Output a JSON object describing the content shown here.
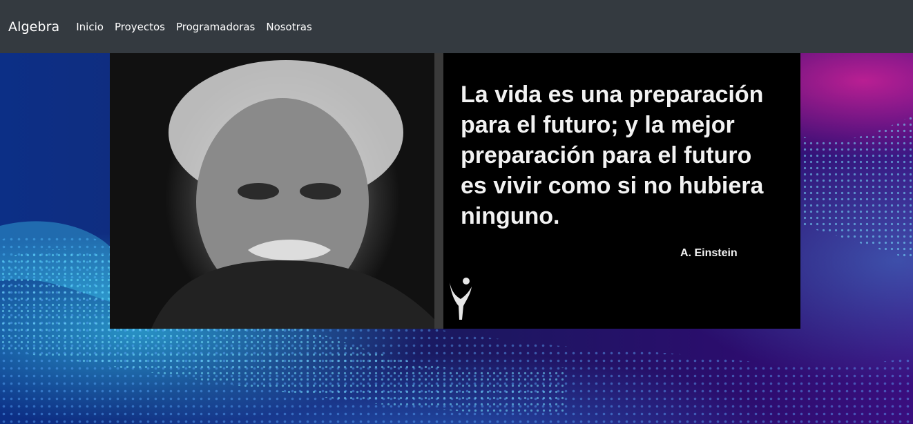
{
  "navbar": {
    "brand": "Algebra",
    "links": [
      {
        "label": "Inicio"
      },
      {
        "label": "Proyectos"
      },
      {
        "label": "Programadoras"
      },
      {
        "label": "Nosotras"
      }
    ]
  },
  "quote": {
    "text": "La vida es una preparación\npara el futuro; y la mejor\npreparación para el futuro\nes vivir como si no hubiera\nninguno.",
    "author": "A. Einstein"
  },
  "colors": {
    "navbar_bg": "#343a40",
    "link_color": "#ffffff",
    "quote_bg": "#000000"
  },
  "icons": {
    "logo": "person-figure-logo-icon"
  }
}
